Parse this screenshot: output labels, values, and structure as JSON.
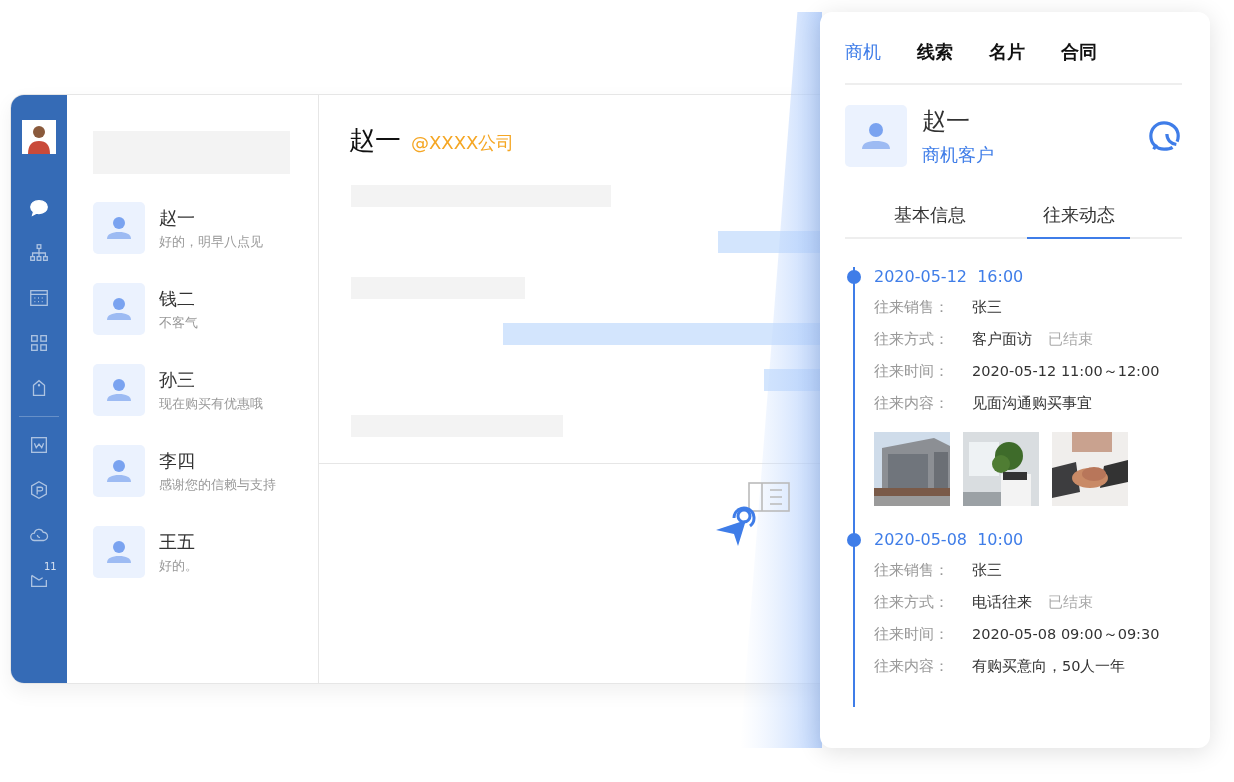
{
  "sidebar": {
    "items": [
      {
        "selected": true
      },
      {
        "selected": false
      },
      {
        "selected": false
      },
      {
        "selected": false
      },
      {
        "selected": false
      },
      {
        "selected": false
      },
      {
        "selected": false
      },
      {
        "selected": false
      },
      {
        "selected": false,
        "badge": "11"
      }
    ]
  },
  "contacts": [
    {
      "name": "赵一",
      "preview": "好的，明早八点见"
    },
    {
      "name": "钱二",
      "preview": "不客气"
    },
    {
      "name": "孙三",
      "preview": "现在购买有优惠哦"
    },
    {
      "name": "李四",
      "preview": "感谢您的信赖与支持"
    },
    {
      "name": "王五",
      "preview": "好的。"
    }
  ],
  "chat": {
    "name": "赵一",
    "company": "@XXXX公司",
    "messages": [
      {
        "kind": "in"
      },
      {
        "kind": "out"
      },
      {
        "kind": "in"
      },
      {
        "kind": "out"
      },
      {
        "kind": "out"
      },
      {
        "kind": "in"
      }
    ]
  },
  "panel": {
    "tabs": [
      {
        "label": "商机",
        "selected": true
      },
      {
        "label": "线索",
        "selected": false
      },
      {
        "label": "名片",
        "selected": false
      },
      {
        "label": "合同",
        "selected": false
      }
    ],
    "customer": {
      "name": "赵一",
      "type": "商机客户"
    },
    "subtabs": [
      {
        "label": "基本信息",
        "selected": false
      },
      {
        "label": "往来动态",
        "selected": true
      }
    ],
    "timeline": [
      {
        "datetime": "2020-05-12  16:00",
        "fields": [
          {
            "label": "往来销售：",
            "value": "张三"
          },
          {
            "label": "往来方式：",
            "value": "客户面访",
            "status": "已结束"
          },
          {
            "label": "往来时间：",
            "value": "2020-05-12 11:00～12:00"
          },
          {
            "label": "往来内容：",
            "value": "见面沟通购买事宜"
          }
        ],
        "photos": [
          {
            "kind": "picture"
          },
          {
            "kind": "picture"
          },
          {
            "kind": "picture"
          }
        ]
      },
      {
        "datetime": "2020-05-08  10:00",
        "fields": [
          {
            "label": "往来销售：",
            "value": "张三"
          },
          {
            "label": "往来方式：",
            "value": "电话往来",
            "status": "已结束"
          },
          {
            "label": "往来时间：",
            "value": "2020-05-08 09:00～09:30"
          },
          {
            "label": "往来内容：",
            "value": "有购买意向，50人一年"
          }
        ]
      }
    ]
  }
}
